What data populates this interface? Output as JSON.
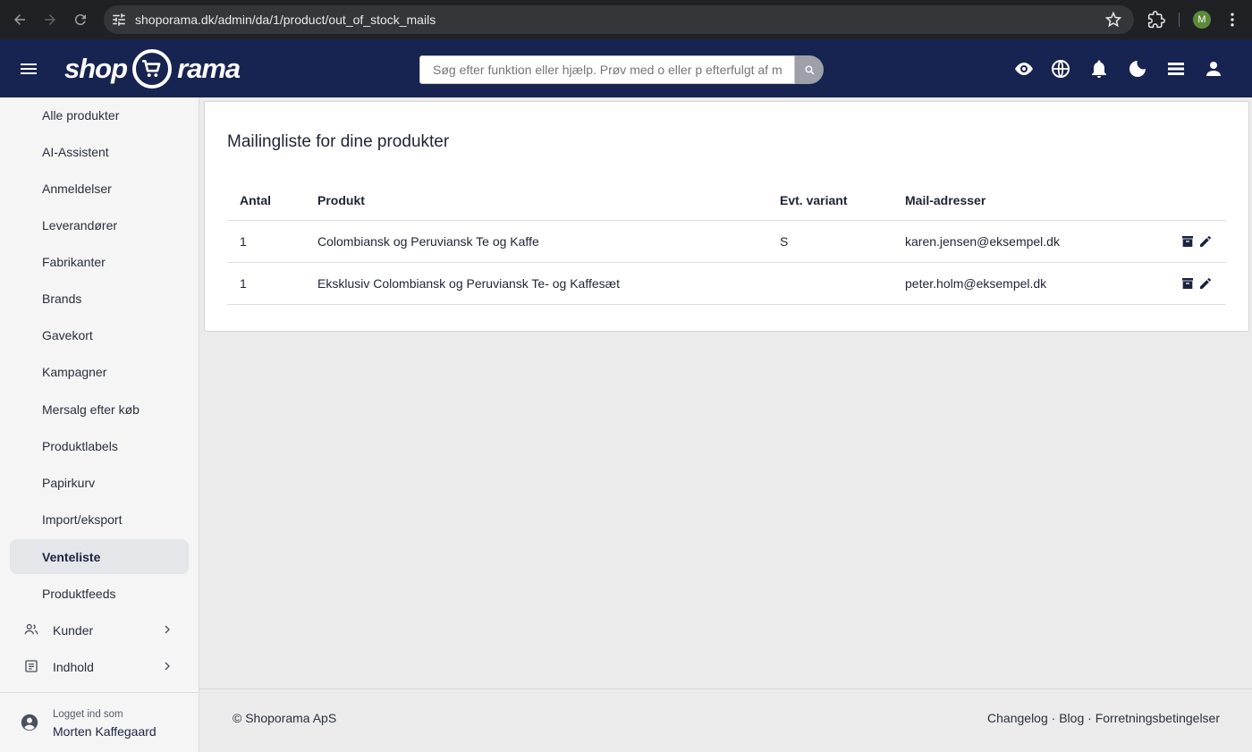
{
  "browser": {
    "url_host": "shoporama.dk",
    "url_path": "/admin/da/1/product/out_of_stock_mails",
    "profile_initial": "M"
  },
  "header": {
    "logo_left": "shop",
    "logo_right": "rama",
    "search_placeholder": "Søg efter funktion eller hjælp. Prøv med o eller p efterfulgt af mellemrum"
  },
  "sidebar": {
    "items": [
      {
        "label": "Alle produkter"
      },
      {
        "label": "AI-Assistent"
      },
      {
        "label": "Anmeldelser"
      },
      {
        "label": "Leverandører"
      },
      {
        "label": "Fabrikanter"
      },
      {
        "label": "Brands"
      },
      {
        "label": "Gavekort"
      },
      {
        "label": "Kampagner"
      },
      {
        "label": "Mersalg efter køb"
      },
      {
        "label": "Produktlabels"
      },
      {
        "label": "Papirkurv"
      },
      {
        "label": "Import/eksport"
      },
      {
        "label": "Venteliste"
      },
      {
        "label": "Produktfeeds"
      }
    ],
    "active": "Venteliste",
    "groups": [
      {
        "label": "Kunder",
        "icon": "people-icon"
      },
      {
        "label": "Indhold",
        "icon": "article-icon"
      }
    ],
    "user_caption": "Logget ind som",
    "user_name": "Morten Kaffegaard"
  },
  "main": {
    "title": "Mailingliste for dine produkter",
    "columns": [
      "Antal",
      "Produkt",
      "Evt. variant",
      "Mail-adresser"
    ],
    "rows": [
      {
        "antal": "1",
        "produkt": "Colombiansk og Peruviansk Te og Kaffe",
        "variant": "S",
        "mail": "karen.jensen@eksempel.dk"
      },
      {
        "antal": "1",
        "produkt": "Eksklusiv Colombiansk og Peruviansk Te- og Kaffesæt",
        "variant": "",
        "mail": "peter.holm@eksempel.dk"
      }
    ]
  },
  "footer": {
    "copyright": "© Shoporama ApS",
    "links": [
      "Changelog",
      "Blog",
      "Forretningsbetingelser"
    ],
    "separator": " · "
  },
  "colors": {
    "header_bg": "#172350",
    "browser_bg": "#202124",
    "active_bg": "#e4e6ea",
    "page_bg": "#ebebeb"
  }
}
